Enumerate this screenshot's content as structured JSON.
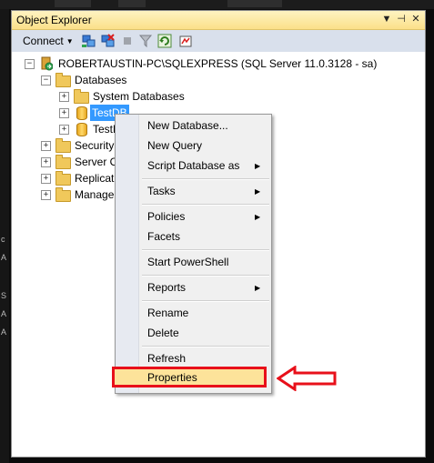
{
  "window": {
    "title": "Object Explorer",
    "title_buttons": [
      "▼",
      "⊣",
      "✕"
    ]
  },
  "toolbar": {
    "connect_label": "Connect",
    "icons": [
      "connect-object-explorer-icon",
      "disconnect-icon",
      "stop-icon",
      "filter-icon",
      "refresh-icon",
      "activity-monitor-icon"
    ]
  },
  "tree": {
    "server": "ROBERTAUSTIN-PC\\SQLEXPRESS (SQL Server 11.0.3128 - sa)",
    "databases": "Databases",
    "system_databases": "System Databases",
    "testdb": "TestDB",
    "testdb2": "TestD",
    "security": "Security",
    "server_objects": "Server O",
    "replication": "Replicati",
    "management": "Manage"
  },
  "context_menu": {
    "new_database": "New Database...",
    "new_query": "New Query",
    "script_database_as": "Script Database as",
    "tasks": "Tasks",
    "policies": "Policies",
    "facets": "Facets",
    "start_powershell": "Start PowerShell",
    "reports": "Reports",
    "rename": "Rename",
    "delete": "Delete",
    "refresh": "Refresh",
    "properties": "Properties"
  },
  "colors": {
    "title_bar": "#fbe089",
    "toolbar": "#d9e0ec",
    "selection": "#3399ff",
    "highlight_box": "#e8101a",
    "highlight_fill": "#fde39a"
  }
}
